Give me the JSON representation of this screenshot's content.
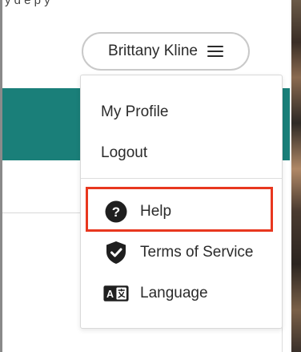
{
  "background": {
    "top_cut_text": "y  d  e  p  y"
  },
  "user_menu": {
    "user_name": "Brittany Kline",
    "toggle_icon": "hamburger-icon"
  },
  "dropdown": {
    "items": [
      {
        "label": "My Profile"
      },
      {
        "label": "Logout"
      },
      {
        "label": "Help",
        "icon": "help-circle-icon",
        "highlighted": true
      },
      {
        "label": "Terms of Service",
        "icon": "shield-check-icon"
      },
      {
        "label": "Language",
        "icon": "translate-icon"
      }
    ]
  },
  "colors": {
    "accent_teal": "#1a7f79",
    "highlight_red": "#e8371f",
    "text": "#2b2b2b"
  }
}
